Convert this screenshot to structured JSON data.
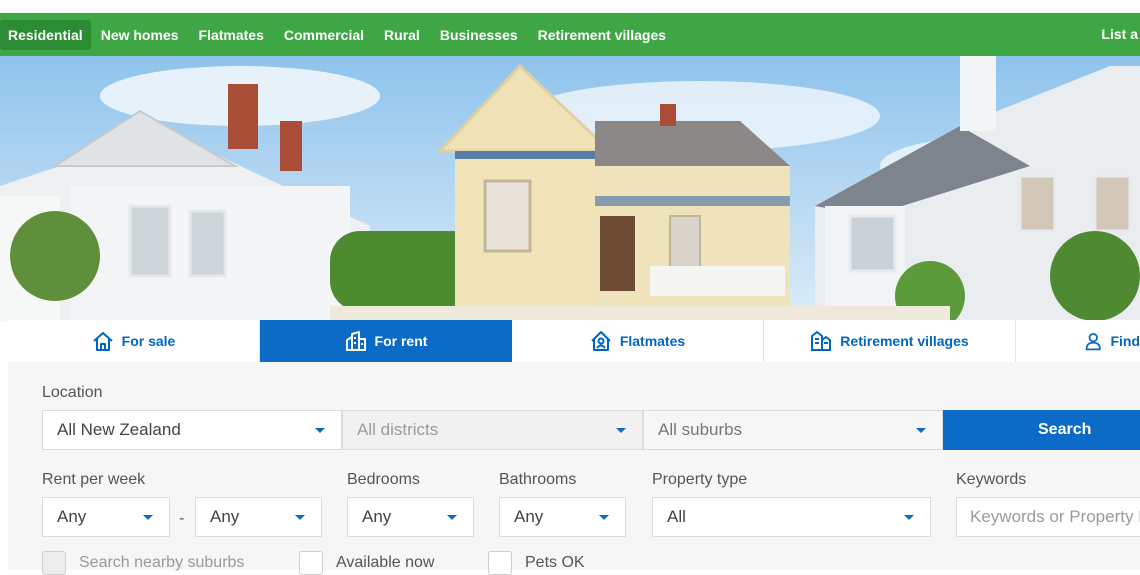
{
  "nav": {
    "items": [
      "Residential",
      "New homes",
      "Flatmates",
      "Commercial",
      "Rural",
      "Businesses",
      "Retirement villages"
    ],
    "right_label": "List a"
  },
  "tabs": [
    {
      "label": "For sale",
      "icon": "house-icon"
    },
    {
      "label": "For rent",
      "icon": "buildings-icon"
    },
    {
      "label": "Flatmates",
      "icon": "house-person-icon"
    },
    {
      "label": "Retirement villages",
      "icon": "village-icon"
    },
    {
      "label": "Find",
      "icon": "person-icon"
    }
  ],
  "search": {
    "location_label": "Location",
    "region_value": "All New Zealand",
    "district_value": "All districts",
    "suburb_value": "All suburbs",
    "search_button": "Search",
    "rent_label": "Rent per week",
    "rent_min": "Any",
    "rent_max": "Any",
    "rent_separator": "-",
    "bedrooms_label": "Bedrooms",
    "bedrooms_value": "Any",
    "bathrooms_label": "Bathrooms",
    "bathrooms_value": "Any",
    "property_type_label": "Property type",
    "property_type_value": "All",
    "keywords_label": "Keywords",
    "keywords_placeholder": "Keywords or Property ID",
    "nearby_label": "Search nearby suburbs",
    "available_label": "Available now",
    "pets_label": "Pets OK"
  },
  "colors": {
    "nav_green": "#3ea645",
    "accent_blue": "#0b6bc6"
  }
}
